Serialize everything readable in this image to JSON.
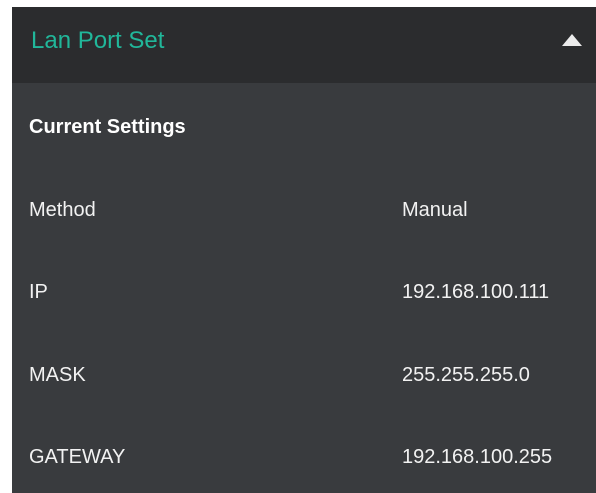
{
  "panel": {
    "title": "Lan Port Set",
    "title_color": "#21b79a",
    "toggle_icon": "collapse-up-triangle-icon"
  },
  "current_settings": {
    "heading": "Current Settings",
    "rows": [
      {
        "label": "Method",
        "value": "Manual"
      },
      {
        "label": "IP",
        "value": "192.168.100.111"
      },
      {
        "label": "MASK",
        "value": "255.255.255.0"
      },
      {
        "label": "GATEWAY",
        "value": "192.168.100.255"
      }
    ]
  }
}
